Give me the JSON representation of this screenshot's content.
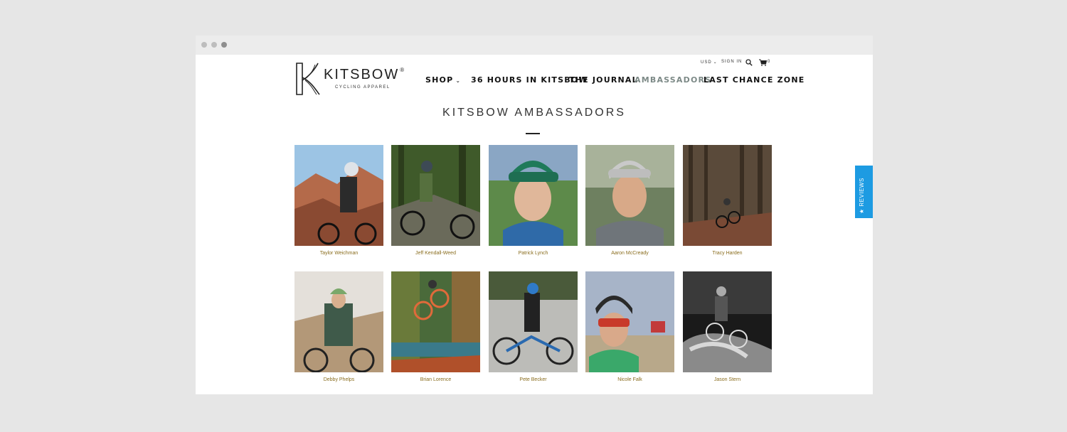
{
  "header": {
    "brand": "KITSBOW",
    "brand_mark": "®",
    "tagline": "CYCLING APPAREL",
    "currency": "USD",
    "sign_in": "SIGN IN",
    "cart_count": "0"
  },
  "nav": {
    "shop": "SHOP",
    "hours": "36 HOURS IN KITSBOW",
    "journal": "THE JOURNAL",
    "ambassadors": "AMBASSADORS",
    "last_chance": "LAST CHANCE ZONE"
  },
  "page": {
    "title": "KITSBOW AMBASSADORS"
  },
  "ambassadors": [
    {
      "name": "Taylor Weichman"
    },
    {
      "name": "Jeff Kendall-Weed"
    },
    {
      "name": "Patrick Lynch"
    },
    {
      "name": "Aaron McCready"
    },
    {
      "name": "Tracy Harden"
    },
    {
      "name": "Debby Phelps"
    },
    {
      "name": "Brian Lorence"
    },
    {
      "name": "Pete Becker"
    },
    {
      "name": "Nicole Falk"
    },
    {
      "name": "Jason Stern"
    }
  ],
  "reviews_tab": {
    "label": "★ REVIEWS"
  },
  "colors": {
    "accent": "#8a6d1e",
    "active_nav": "#7d8a87",
    "reviews": "#1d9be2"
  }
}
